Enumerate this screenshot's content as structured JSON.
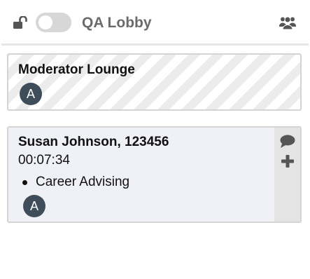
{
  "header": {
    "lock_icon": "unlocked-padlock-icon",
    "toggle_state": "off",
    "title": "QA Lobby",
    "users_icon": "users-group-icon"
  },
  "colors": {
    "title_gray": "#6b6b6b",
    "icon_dark": "#555555",
    "avatar_bg": "#3e4d59",
    "card_border": "#d4d4d4",
    "session_bg": "#eff1f6",
    "actions_bg": "#e4e4e4"
  },
  "moderator_room": {
    "title": "Moderator Lounge",
    "avatars": [
      "A"
    ]
  },
  "session": {
    "title": "Susan Johnson, 123456",
    "timer": "00:07:34",
    "services": [
      "Career Advising"
    ],
    "avatars": [
      "A"
    ],
    "actions": [
      "chat-bubble-icon",
      "plus-icon"
    ]
  }
}
